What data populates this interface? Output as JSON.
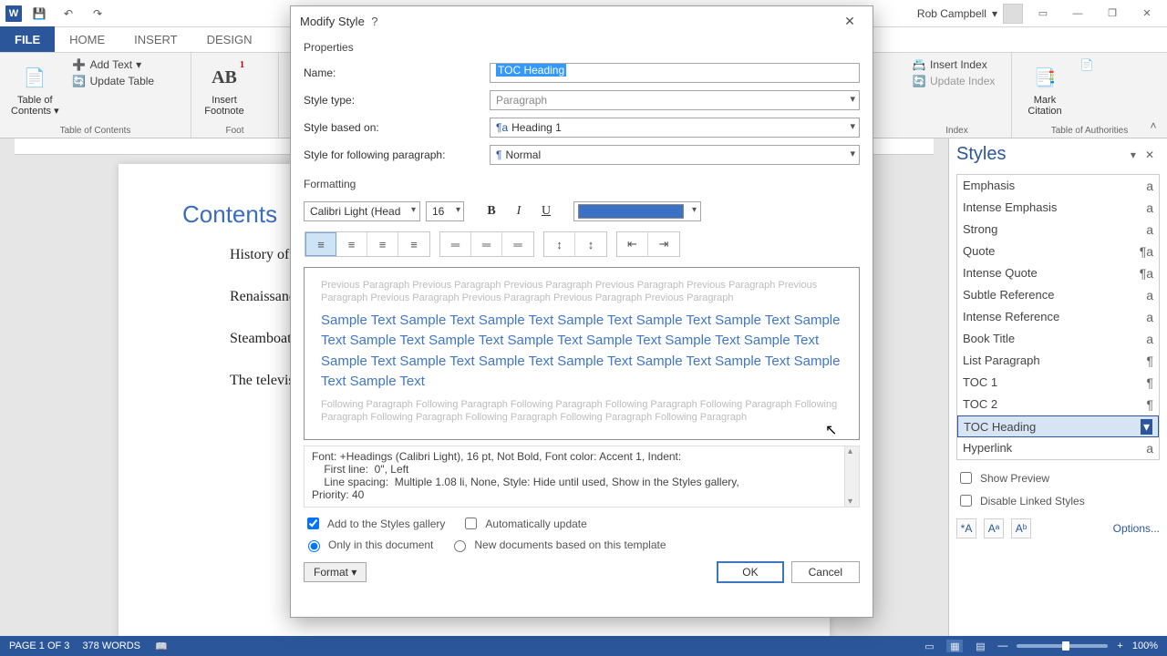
{
  "titlebar": {
    "user_name": "Rob Campbell"
  },
  "tabs": [
    "FILE",
    "HOME",
    "INSERT",
    "DESIGN"
  ],
  "ribbon": {
    "toc_group": {
      "label": "Table of Contents",
      "big_label": "Table of\nContents",
      "add_text": "Add Text",
      "update_table": "Update Table"
    },
    "foot_group": {
      "big_label": "Insert\nFootnote",
      "ab_label": "AB"
    },
    "index_group": {
      "label": "Index",
      "insert": "Insert Index",
      "update": "Update Index"
    },
    "citation_group": {
      "label": "Table of Authorities",
      "big_label": "Mark\nCitation"
    }
  },
  "document": {
    "contents_title": "Contents",
    "toc_lines": [
      "History of Animation",
      "Renaissance Era",
      "Steamboat Willie",
      "The television era"
    ]
  },
  "styles_pane": {
    "title": "Styles",
    "items": [
      {
        "name": "Emphasis",
        "glyph": "a"
      },
      {
        "name": "Intense Emphasis",
        "glyph": "a"
      },
      {
        "name": "Strong",
        "glyph": "a"
      },
      {
        "name": "Quote",
        "glyph": "¶a"
      },
      {
        "name": "Intense Quote",
        "glyph": "¶a"
      },
      {
        "name": "Subtle Reference",
        "glyph": "a"
      },
      {
        "name": "Intense Reference",
        "glyph": "a"
      },
      {
        "name": "Book Title",
        "glyph": "a"
      },
      {
        "name": "List Paragraph",
        "glyph": "¶"
      },
      {
        "name": "TOC 1",
        "glyph": "¶"
      },
      {
        "name": "TOC 2",
        "glyph": "¶"
      },
      {
        "name": "TOC Heading",
        "glyph": "¶",
        "selected": true
      },
      {
        "name": "Hyperlink",
        "glyph": "a"
      }
    ],
    "show_preview": "Show Preview",
    "disable_linked": "Disable Linked Styles",
    "options": "Options..."
  },
  "dialog": {
    "title": "Modify Style",
    "section_props": "Properties",
    "name_label": "Name:",
    "name_value": "TOC Heading",
    "type_label": "Style type:",
    "type_value": "Paragraph",
    "based_label": "Style based on:",
    "based_value": "Heading 1",
    "following_label": "Style for following paragraph:",
    "following_value": "Normal",
    "section_fmt": "Formatting",
    "font_name": "Calibri Light (Head",
    "font_size": "16",
    "prev_gray_before": "Previous Paragraph Previous Paragraph Previous Paragraph Previous Paragraph Previous Paragraph Previous Paragraph Previous Paragraph Previous Paragraph Previous Paragraph Previous Paragraph",
    "sample_text": "Sample Text Sample Text Sample Text Sample Text Sample Text Sample Text Sample Text Sample Text Sample Text Sample Text Sample Text Sample Text Sample Text Sample Text Sample Text Sample Text Sample Text Sample Text Sample Text Sample Text Sample Text",
    "prev_gray_after": "Following Paragraph Following Paragraph Following Paragraph Following Paragraph Following Paragraph Following Paragraph Following Paragraph Following Paragraph Following Paragraph Following Paragraph",
    "desc_line1": "Font: +Headings (Calibri Light), 16 pt, Not Bold, Font color: Accent 1, Indent:",
    "desc_line2": "    First line:  0\", Left",
    "desc_line3": "    Line spacing:  Multiple 1.08 li, None, Style: Hide until used, Show in the Styles gallery,",
    "desc_line4": "Priority: 40",
    "chk_gallery": "Add to the Styles gallery",
    "chk_auto": "Automatically update",
    "radio_doc": "Only in this document",
    "radio_template": "New documents based on this template",
    "format_btn": "Format",
    "ok": "OK",
    "cancel": "Cancel"
  },
  "status": {
    "page": "PAGE 1 OF 3",
    "words": "378 WORDS",
    "zoom": "100%"
  }
}
